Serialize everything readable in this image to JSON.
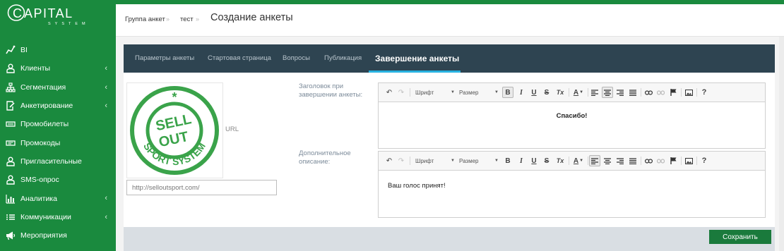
{
  "brand": {
    "name": "CAPITAL",
    "tagline": "SYSTEM"
  },
  "sidebar": {
    "items": [
      {
        "label": "BI",
        "icon": "chart-line-icon",
        "chevron": ""
      },
      {
        "label": "Клиенты",
        "icon": "users-icon",
        "chevron": "‹"
      },
      {
        "label": "Сегментация",
        "icon": "sitemap-icon",
        "chevron": "‹"
      },
      {
        "label": "Анкетирование",
        "icon": "form-edit-icon",
        "chevron": "‹"
      },
      {
        "label": "Промобилеты",
        "icon": "ticket-icon",
        "chevron": ""
      },
      {
        "label": "Промокоды",
        "icon": "barcode-icon",
        "chevron": ""
      },
      {
        "label": "Пригласительные",
        "icon": "user-plus-icon",
        "chevron": ""
      },
      {
        "label": "SMS-опрос",
        "icon": "user-sms-icon",
        "chevron": ""
      },
      {
        "label": "Аналитика",
        "icon": "bar-chart-icon",
        "chevron": "‹"
      },
      {
        "label": "Коммуникации",
        "icon": "list-icon",
        "chevron": "‹"
      },
      {
        "label": "Мероприятия",
        "icon": "megaphone-icon",
        "chevron": ""
      }
    ]
  },
  "breadcrumb": {
    "item1": "Группа анкет",
    "item2": "тест",
    "separator": "»"
  },
  "page": {
    "title": "Создание анкеты"
  },
  "tabs": [
    {
      "label": "Параметры анкеты",
      "active": false
    },
    {
      "label": "Стартовая страница",
      "active": false
    },
    {
      "label": "Вопросы",
      "active": false
    },
    {
      "label": "Публикация",
      "active": false
    },
    {
      "label": "Завершение анкеты",
      "active": true
    }
  ],
  "image": {
    "logo_text": [
      "SELL",
      "OUT"
    ],
    "ring_text": "SPORT SYSTEM",
    "url_label": "URL",
    "url_value": "http://selloutsport.com/"
  },
  "toolbar": {
    "font_label": "Шрифт",
    "size_label": "Размер",
    "bold": "B",
    "italic": "I",
    "underline": "U",
    "strike": "S",
    "clear_format": "Tx",
    "text_color": "A",
    "help": "?"
  },
  "form": {
    "header_label": "Заголовок при завершении анкеты:",
    "header_text": "Спасибо!",
    "description_label": "Дополнительное описание:",
    "description_text": "Ваш голос принят!"
  },
  "actions": {
    "save_label": "Сохранить"
  },
  "colors": {
    "sidebar": "#1a8a3e",
    "tabbar": "#2e4451",
    "tab_underline": "#28b2e0",
    "save": "#1a7a3c",
    "actionbar": "#d9dee3"
  }
}
